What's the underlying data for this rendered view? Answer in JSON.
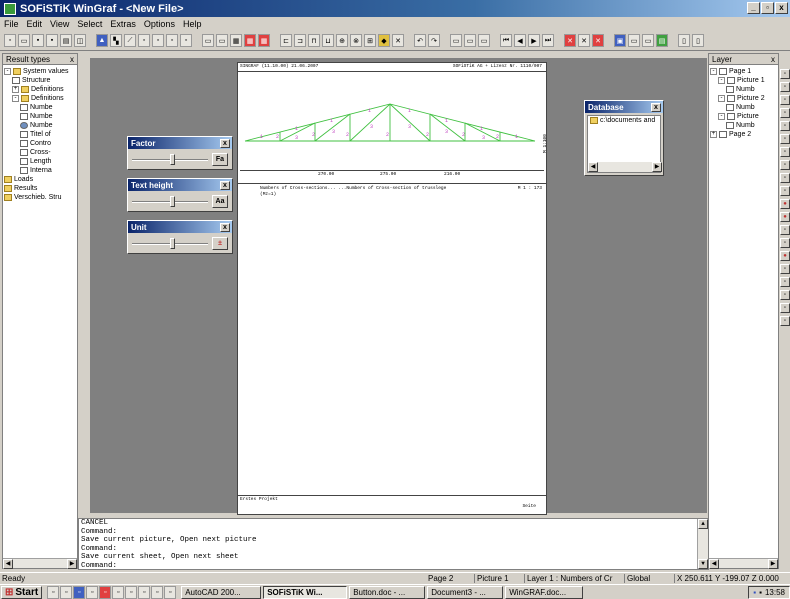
{
  "window": {
    "title": "SOFiSTiK WinGraf - <New File>",
    "min": "_",
    "max": "▫",
    "close": "x"
  },
  "menu": [
    "File",
    "Edit",
    "View",
    "Select",
    "Extras",
    "Options",
    "Help"
  ],
  "left_panel": {
    "title": "Result types",
    "close": "x",
    "items": [
      {
        "label": "System values",
        "icon": "folder",
        "indent": 0,
        "expander": "-"
      },
      {
        "label": "Structure",
        "icon": "page",
        "indent": 1,
        "expander": ""
      },
      {
        "label": "Definitions",
        "icon": "folder",
        "indent": 1,
        "expander": "+"
      },
      {
        "label": "Definitions",
        "icon": "folder",
        "indent": 1,
        "expander": "-"
      },
      {
        "label": "Numbe",
        "icon": "page",
        "indent": 2,
        "expander": ""
      },
      {
        "label": "Numbe",
        "icon": "page",
        "indent": 2,
        "expander": ""
      },
      {
        "label": "Numbe",
        "icon": "check",
        "indent": 2,
        "expander": ""
      },
      {
        "label": "Titel of",
        "icon": "page",
        "indent": 2,
        "expander": ""
      },
      {
        "label": "Contro",
        "icon": "page",
        "indent": 2,
        "expander": ""
      },
      {
        "label": "Cross-",
        "icon": "page",
        "indent": 2,
        "expander": ""
      },
      {
        "label": "Length",
        "icon": "page",
        "indent": 2,
        "expander": ""
      },
      {
        "label": "Interna",
        "icon": "page",
        "indent": 2,
        "expander": ""
      },
      {
        "label": "Loads",
        "icon": "folder",
        "indent": 0,
        "expander": ""
      },
      {
        "label": "Results",
        "icon": "folder",
        "indent": 0,
        "expander": ""
      },
      {
        "label": "Verschieb. Stru",
        "icon": "folder",
        "indent": 0,
        "expander": ""
      }
    ]
  },
  "right_panel": {
    "title": "Layer",
    "close": "x",
    "items": [
      {
        "label": "Page  1",
        "indent": 0,
        "expander": "-"
      },
      {
        "label": "Picture  1",
        "indent": 1,
        "expander": "-"
      },
      {
        "label": "Numb",
        "indent": 2,
        "expander": ""
      },
      {
        "label": "Picture  2",
        "indent": 1,
        "expander": "-"
      },
      {
        "label": "Numb",
        "indent": 2,
        "expander": ""
      },
      {
        "label": "Picture",
        "indent": 1,
        "expander": "-"
      },
      {
        "label": "Numb",
        "indent": 2,
        "expander": ""
      },
      {
        "label": "Page  2",
        "indent": 0,
        "expander": "+"
      }
    ]
  },
  "tool_windows": {
    "factor": {
      "title": "Factor",
      "button": "Fa",
      "close": "x"
    },
    "text_height": {
      "title": "Text height",
      "button": "Aa",
      "close": "x"
    },
    "unit": {
      "title": "Unit",
      "button": "±",
      "close": "x"
    }
  },
  "database": {
    "title": "Database",
    "close": "x",
    "item": "c:\\documents and"
  },
  "sheet": {
    "header_left": "SINGRAF  (11.10.00)  21.06.2007",
    "header_right": "SOFiSTiK AG  +  Lizenz Nr. 1110/007",
    "dims": [
      "270.00",
      "275.00",
      "216.00"
    ],
    "side_label": "M 1:100",
    "caption": "Numbers of Cross-sections...  ...Numbers of Cross-section of trusslege",
    "caption_sub": "(Mz=1)",
    "page_ref": "M 1 : 173",
    "footer_left": "Erstes Projekt",
    "footer_right": "Seite"
  },
  "command_log": [
    "CANCEL",
    "Command:",
    "Save current picture, Open next picture",
    "Command:",
    "Save current sheet, Open next sheet",
    "Command:"
  ],
  "status": {
    "ready": "Ready",
    "page": "Page   2",
    "picture": "Picture   1",
    "layer": "Layer   1 : Numbers of Cr",
    "global": "Global",
    "coords": "X 250.611  Y -199.07  Z 0.000"
  },
  "taskbar": {
    "start": "Start",
    "tasks": [
      {
        "label": "AutoCAD 200...",
        "active": false
      },
      {
        "label": "SOFiSTiK Wi...",
        "active": true
      },
      {
        "label": "Button.doc - ...",
        "active": false
      },
      {
        "label": "Document3 - ...",
        "active": false
      },
      {
        "label": "WinGRAF.doc...",
        "active": false
      }
    ],
    "time": "13:58"
  }
}
